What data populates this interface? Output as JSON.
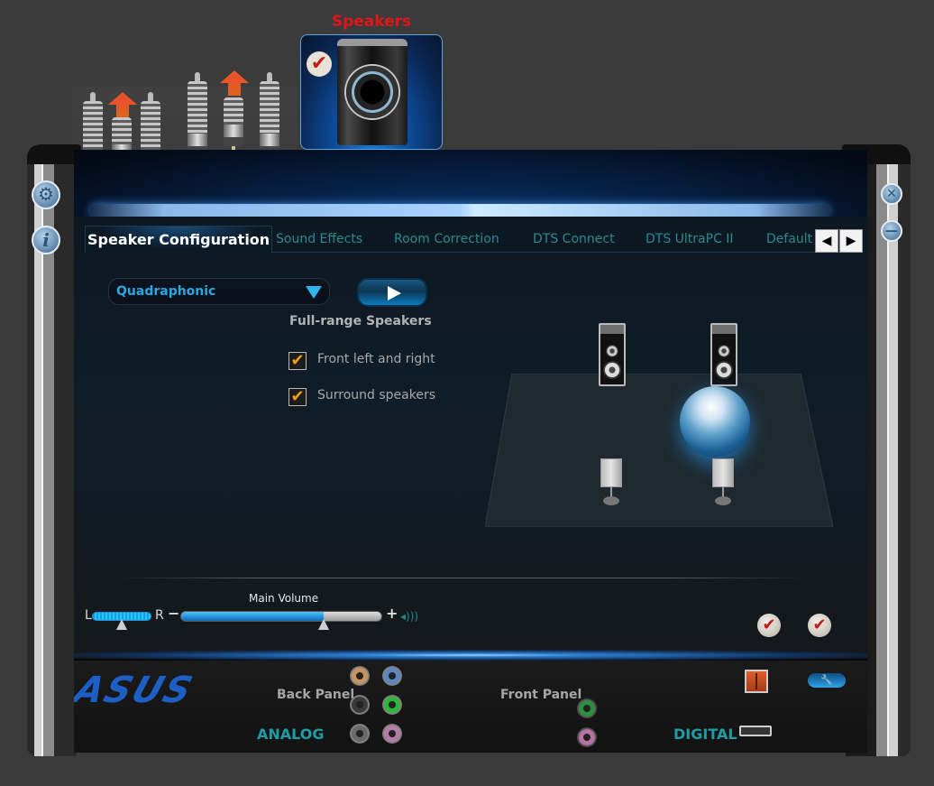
{
  "device": {
    "label": "Speakers",
    "selected": true,
    "icon": "speaker-icon"
  },
  "jacks_top": {
    "icons": [
      "rca-plug-icon",
      "arrow-up-icon",
      "rca-plug-icon",
      "rca-plug-icon",
      "arrow-up-icon",
      "rca-plug-icon"
    ]
  },
  "side_left": {
    "settings_icon": "gear-icon",
    "info_icon": "info-icon",
    "info_glyph": "i"
  },
  "side_right": {
    "close_icon": "close-icon",
    "close_glyph": "✕",
    "minimize_icon": "minimize-icon",
    "minimize_glyph": "—"
  },
  "tabs": [
    {
      "label": "Speaker Configuration",
      "active": true
    },
    {
      "label": "Sound Effects",
      "active": false
    },
    {
      "label": "Room Correction",
      "active": false
    },
    {
      "label": "DTS Connect",
      "active": false
    },
    {
      "label": "DTS UltraPC II",
      "active": false
    },
    {
      "label": "Default",
      "active": false
    }
  ],
  "tab_nav": {
    "prev": "◀",
    "next": "▶"
  },
  "config": {
    "speaker_mode": "Quadraphonic",
    "play_icon": "play-icon",
    "group_title": "Full-range Speakers",
    "options": [
      {
        "label": "Front left and right",
        "checked": true
      },
      {
        "label": "Surround speakers",
        "checked": true
      }
    ],
    "check_glyph": "✔"
  },
  "diagram": {
    "speakers": [
      "front-left",
      "front-right",
      "surround-left",
      "surround-right"
    ],
    "listener": "listener-sphere"
  },
  "volume": {
    "title": "Main Volume",
    "left_label": "L",
    "right_label": "R",
    "minus": "−",
    "plus": "+",
    "speaker_glyph": "◂)))",
    "balance_percent": 50,
    "level_percent": 71
  },
  "actions": {
    "set_default_glyph": "✔",
    "mute_glyph": "✔"
  },
  "bottom": {
    "brand": "ASUS",
    "back_panel_label": "Back Panel",
    "front_panel_label": "Front Panel",
    "analog_label": "ANALOG",
    "digital_label": "DIGITAL",
    "wrench_glyph": "🔧",
    "back_jacks": [
      {
        "name": "orange",
        "color": "#c9925e"
      },
      {
        "name": "blue",
        "color": "#5a86c4"
      },
      {
        "name": "black",
        "color": "#3a3a3a"
      },
      {
        "name": "green",
        "color": "#2bb836"
      },
      {
        "name": "gray",
        "color": "#6a6a6a"
      },
      {
        "name": "pink",
        "color": "#b77aa8"
      }
    ],
    "front_jacks": [
      {
        "name": "green",
        "color": "#2f8f40"
      },
      {
        "name": "pink",
        "color": "#b772a4"
      }
    ]
  },
  "colors": {
    "accent_blue": "#27a8e0",
    "tab_inactive": "#2d8a90",
    "device_label_red": "#e0161a",
    "check_orange": "#f1a015",
    "brand_blue": "#1d5fc4"
  }
}
